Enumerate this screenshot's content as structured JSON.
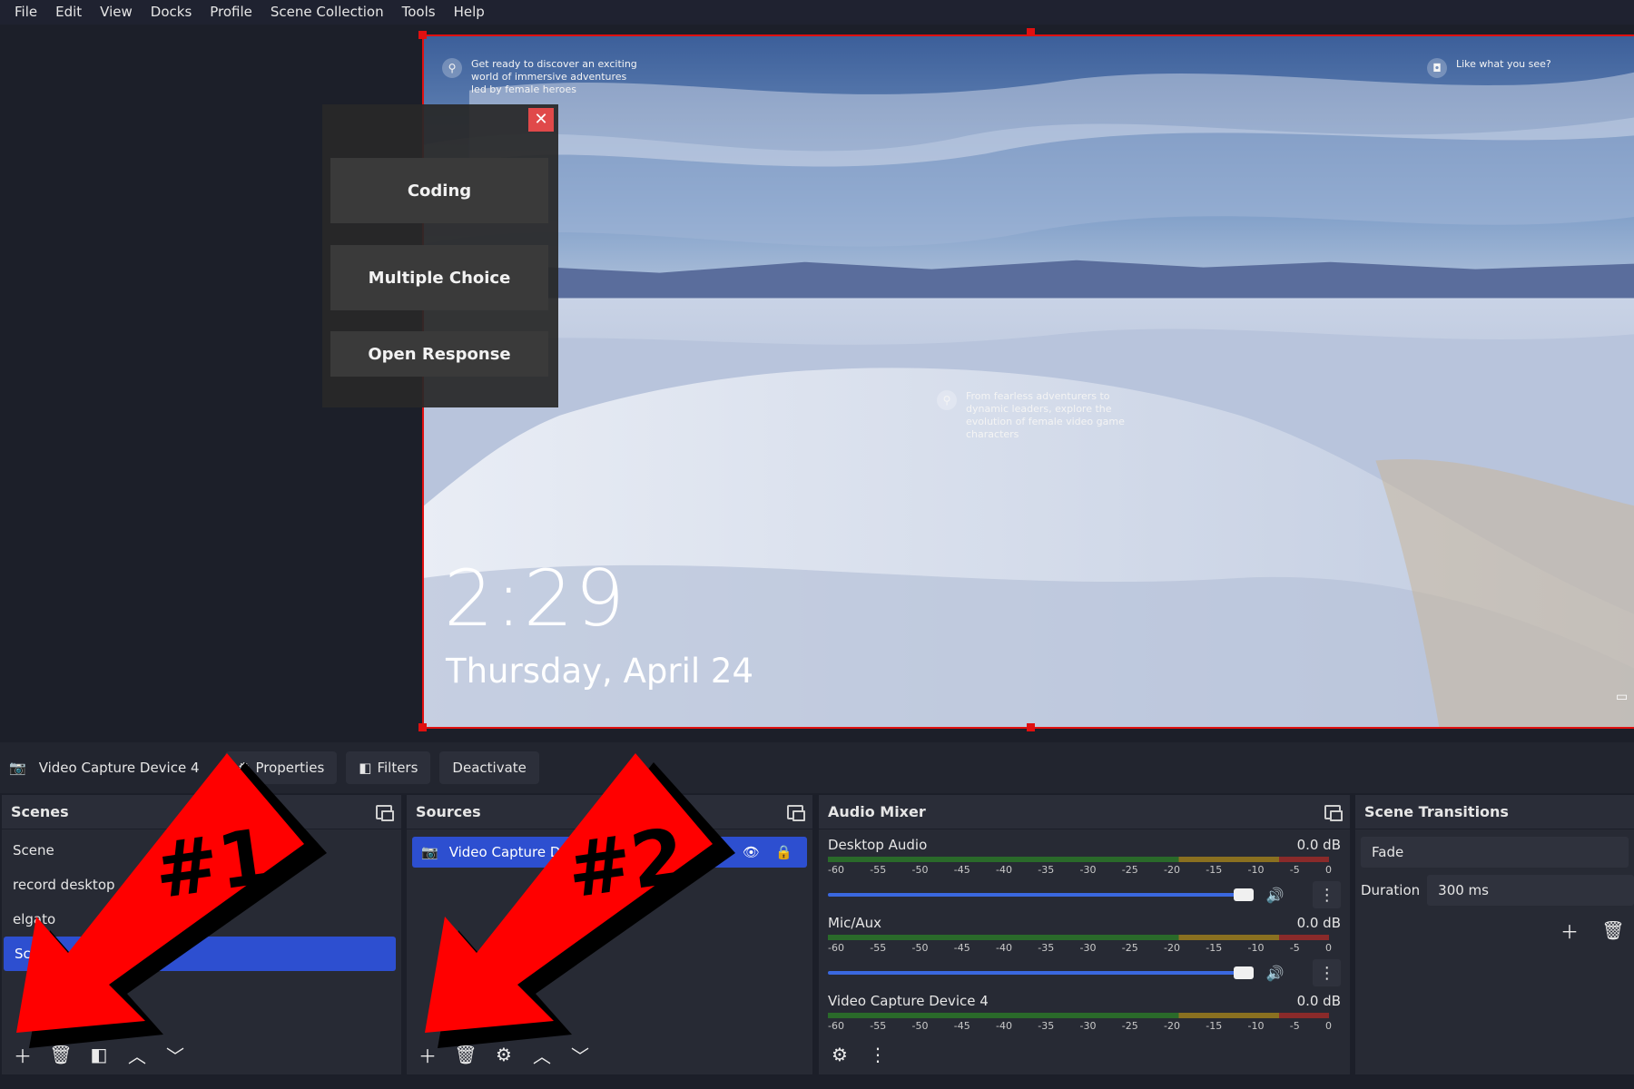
{
  "menu": [
    "File",
    "Edit",
    "View",
    "Docks",
    "Profile",
    "Scene Collection",
    "Tools",
    "Help"
  ],
  "preview": {
    "tip_top_left": "Get ready to discover an exciting world of immersive adventures led by female heroes",
    "tip_top_right": "Like what you see?",
    "tip_middle": "From fearless adventurers to dynamic leaders, explore the evolution of female video game characters",
    "time": "2:29",
    "date": "Thursday, April 24"
  },
  "popup": {
    "close": "✕",
    "buttons": [
      "Coding",
      "Multiple Choice",
      "Open Response"
    ]
  },
  "source_toolbar": {
    "source_name": "Video Capture Device 4",
    "properties": "Properties",
    "filters": "Filters",
    "deactivate": "Deactivate"
  },
  "scenes": {
    "title": "Scenes",
    "items": [
      "Scene",
      "record desktop",
      "elgato",
      "Scer"
    ],
    "selected_index": 3
  },
  "sources": {
    "title": "Sources",
    "items": [
      "Video Capture De"
    ]
  },
  "mixer": {
    "title": "Audio Mixer",
    "ticks": [
      "-60",
      "-55",
      "-50",
      "-45",
      "-40",
      "-35",
      "-30",
      "-25",
      "-20",
      "-15",
      "-10",
      "-5",
      "0"
    ],
    "channels": [
      {
        "name": "Desktop Audio",
        "db": "0.0 dB"
      },
      {
        "name": "Mic/Aux",
        "db": "0.0 dB"
      },
      {
        "name": "Video Capture Device 4",
        "db": "0.0 dB"
      }
    ]
  },
  "transitions": {
    "title": "Scene Transitions",
    "selected": "Fade",
    "duration_label": "Duration",
    "duration_value": "300 ms"
  },
  "annotations": {
    "label1": "#1",
    "label2": "#2",
    "arrow_color": "#ff0000"
  }
}
